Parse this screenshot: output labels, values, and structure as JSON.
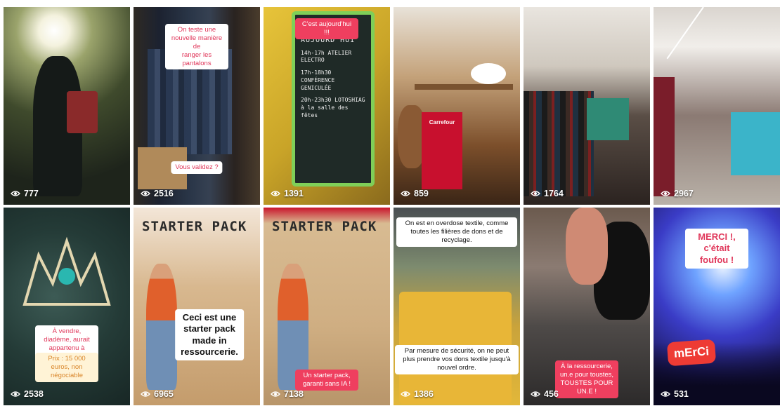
{
  "colors": {
    "sticker_pink": "#ef3f5f",
    "sticker_text_pink": "#e0375a",
    "view_text": "#ffffff"
  },
  "icons": {
    "views": "eye-icon"
  },
  "tiles": [
    {
      "views": "777",
      "stickers": []
    },
    {
      "views": "2516",
      "stickers": [
        "On teste une nouvelle manière de\nranger les pantalons",
        "Vous validez ?"
      ]
    },
    {
      "views": "1391",
      "stickers": [
        "C'est aujourd'hui !!!"
      ],
      "board": {
        "title": "AUJOURD'HUI",
        "lines": [
          "14h-17h  ATELIER ELECTRO",
          "17h-18h30  CONFÉRENCE\nGENICULÉE",
          "20h-23h30  LOTOSHIAG\nà la salle des fêtes"
        ]
      }
    },
    {
      "views": "859",
      "stickers": [],
      "label": "Carrefour"
    },
    {
      "views": "1764",
      "stickers": []
    },
    {
      "views": "2967",
      "stickers": []
    },
    {
      "views": "2538",
      "stickers": [
        "À vendre, diadème, aurait appartenu à\nEugénie...",
        "Prix : 15 000 euros, non négociable"
      ]
    },
    {
      "views": "6965",
      "stickers": [
        "Ceci est une starter pack\nmade in ressourcerie."
      ],
      "sign": "STARTER PACK"
    },
    {
      "views": "7138",
      "stickers": [
        "Un starter pack, garanti sans IA !"
      ],
      "sign": "STARTER PACK"
    },
    {
      "views": "1386",
      "stickers": [
        "On est en overdose textile, comme\ntoutes les filières de dons et de\nrecyclage.",
        "Par mesure de sécurité, on ne peut\nplus prendre vos dons textile jusqu'à\nnouvel ordre."
      ]
    },
    {
      "views": "456",
      "stickers": [
        "À la ressourcerie, un.e pour toustes,\nTOUSTES POUR UN.E !"
      ]
    },
    {
      "views": "531",
      "stickers": [
        "MERCI !, c'était foufou !"
      ],
      "logo": "mErCi"
    }
  ]
}
